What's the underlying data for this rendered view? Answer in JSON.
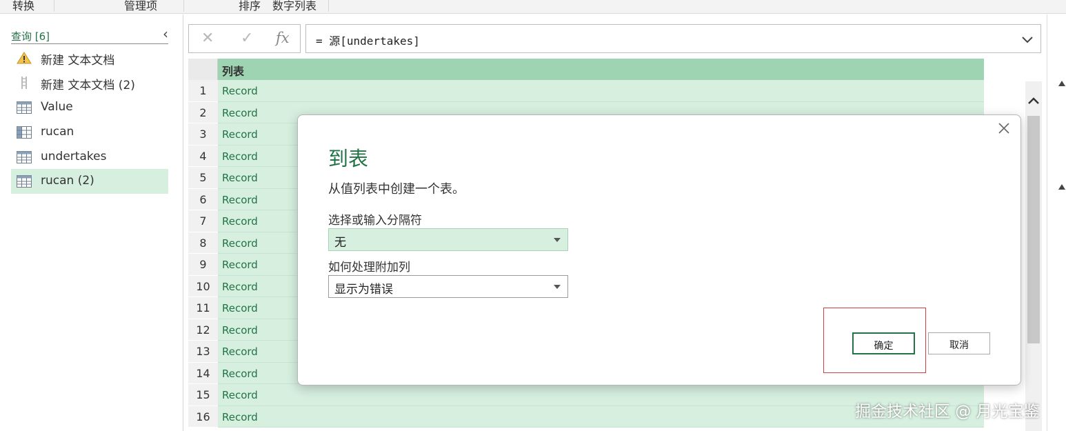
{
  "ribbon": {
    "tab_transform": "转换",
    "tab_manage": "管理项",
    "tab_sort": "排序",
    "tab_numbers": "数字列表"
  },
  "query_pane": {
    "header": "查询 [6]",
    "items": [
      {
        "label": "新建 文本文档",
        "icon": "warning-icon"
      },
      {
        "label": "新建 文本文档 (2)",
        "icon": "list-icon"
      },
      {
        "label": "Value",
        "icon": "table-icon"
      },
      {
        "label": "rucan",
        "icon": "matrix-icon"
      },
      {
        "label": "undertakes",
        "icon": "table-icon"
      },
      {
        "label": "rucan (2)",
        "icon": "table-icon",
        "selected": true
      }
    ]
  },
  "formula_bar": {
    "cancel_glyph": "✕",
    "commit_glyph": "✓",
    "fx_label": "fx",
    "formula": "= 源[undertakes]"
  },
  "grid": {
    "column_header": "列表",
    "rows": [
      {
        "n": "1",
        "v": "Record"
      },
      {
        "n": "2",
        "v": "Record"
      },
      {
        "n": "3",
        "v": "Record"
      },
      {
        "n": "4",
        "v": "Record"
      },
      {
        "n": "5",
        "v": "Record"
      },
      {
        "n": "6",
        "v": "Record"
      },
      {
        "n": "7",
        "v": "Record"
      },
      {
        "n": "8",
        "v": "Record"
      },
      {
        "n": "9",
        "v": "Record"
      },
      {
        "n": "10",
        "v": "Record"
      },
      {
        "n": "11",
        "v": "Record"
      },
      {
        "n": "12",
        "v": "Record"
      },
      {
        "n": "13",
        "v": "Record"
      },
      {
        "n": "14",
        "v": "Record"
      },
      {
        "n": "15",
        "v": "Record"
      },
      {
        "n": "16",
        "v": "Record"
      }
    ]
  },
  "dialog": {
    "title": "到表",
    "subtitle": "从值列表中创建一个表。",
    "delimiter_label": "选择或输入分隔符",
    "delimiter_value": "无",
    "extra_label": "如何处理附加列",
    "extra_value": "显示为错误",
    "ok_label": "确定",
    "cancel_label": "取消"
  },
  "watermark": "掘金技术社区 @ 月光宝鉴",
  "colors": {
    "accent": "#217346",
    "selection": "#d6efdf",
    "header": "#9fd4b3",
    "highlight": "#d04040"
  }
}
